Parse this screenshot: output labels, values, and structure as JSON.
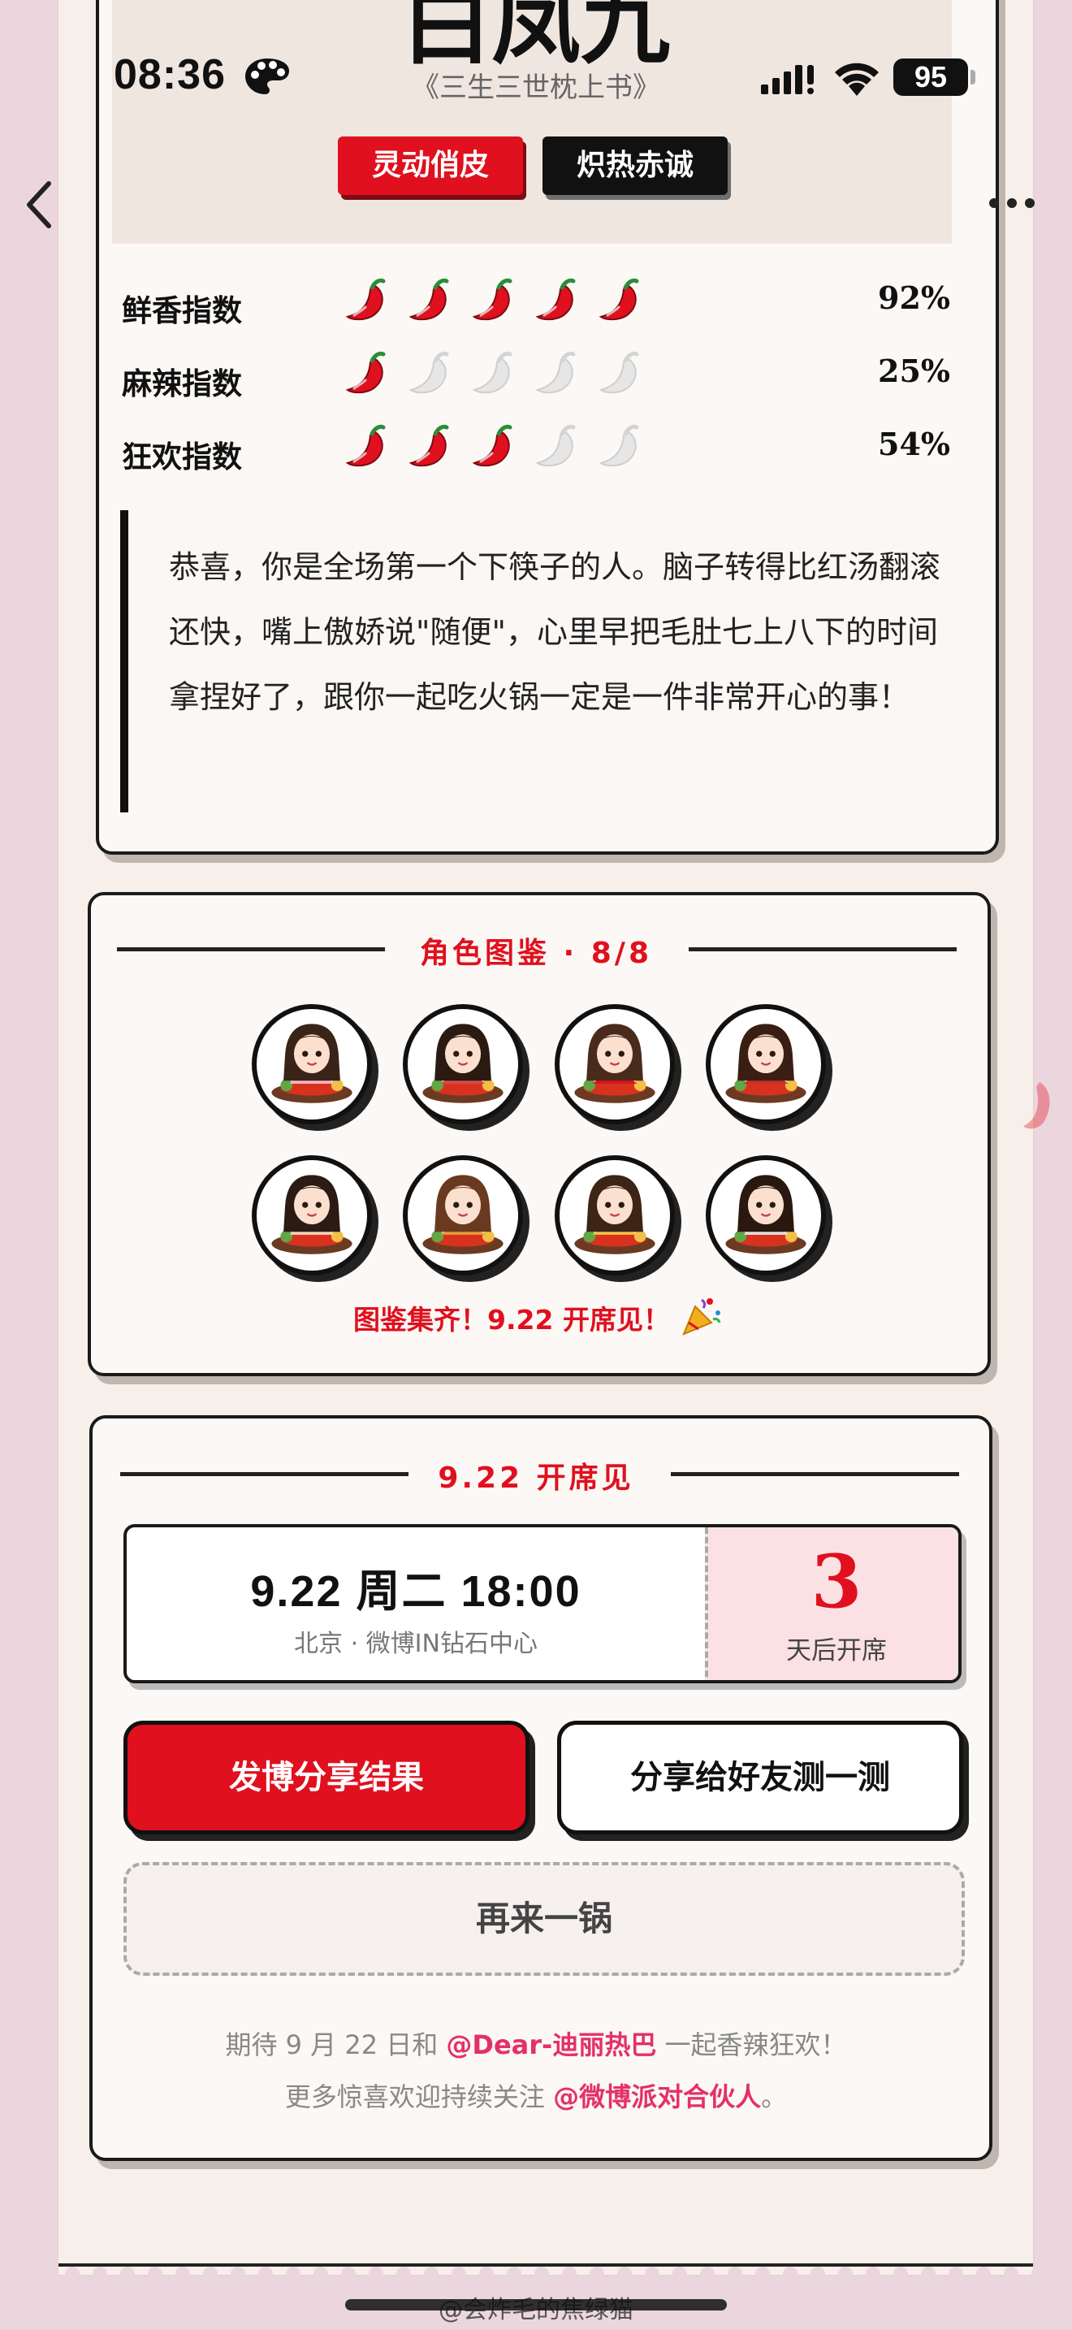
{
  "status_bar": {
    "time": "08:36",
    "battery": "95"
  },
  "hero": {
    "title": "白凤九",
    "subtitle": "《三生三世枕上书》",
    "tags": [
      "灵动俏皮",
      "炽热赤诚"
    ]
  },
  "indices": [
    {
      "label": "鲜香指数",
      "value": "92%",
      "chilis_filled": 5,
      "chilis_total": 5
    },
    {
      "label": "麻辣指数",
      "value": "25%",
      "chilis_filled": 1,
      "chilis_total": 5
    },
    {
      "label": "狂欢指数",
      "value": "54%",
      "chilis_filled": 3,
      "chilis_total": 5
    }
  ],
  "quote": "恭喜，你是全场第一个下筷子的人。脑子转得比红汤翻滚还快，嘴上傲娇说\"随便\"，心里早把毛肚七上八下的时间拿捏好了，跟你一起吃火锅一定是一件非常开心的事！",
  "gallery": {
    "title": "角色图鉴 · 8/8",
    "footer": "图鉴集齐！9.22 开席见！",
    "avatar_count": 8
  },
  "event": {
    "title": "9.22 开席见",
    "date_time": "9.22 周二 18:00",
    "venue": "北京 · 微博IN钻石中心",
    "countdown_number": "3",
    "countdown_label": "天后开席",
    "share_button": "发博分享结果",
    "friend_button": "分享给好友测一测",
    "retry_button": "再来一锅",
    "footer_line1_pre": "期待 9 月 22 日和 ",
    "footer_line1_at": "@Dear-迪丽热巴",
    "footer_line1_post": " 一起香辣狂欢！",
    "footer_line2_pre": "更多惊喜欢迎持续关注 ",
    "footer_line2_at": "@微博派对合伙人",
    "footer_line2_post": "。"
  },
  "watermark": "@会炸毛的焦绿猫",
  "colors": {
    "accent": "#e0101e",
    "mention": "#e4306a",
    "paper": "#f7efe9",
    "background": "#ecd6de"
  }
}
